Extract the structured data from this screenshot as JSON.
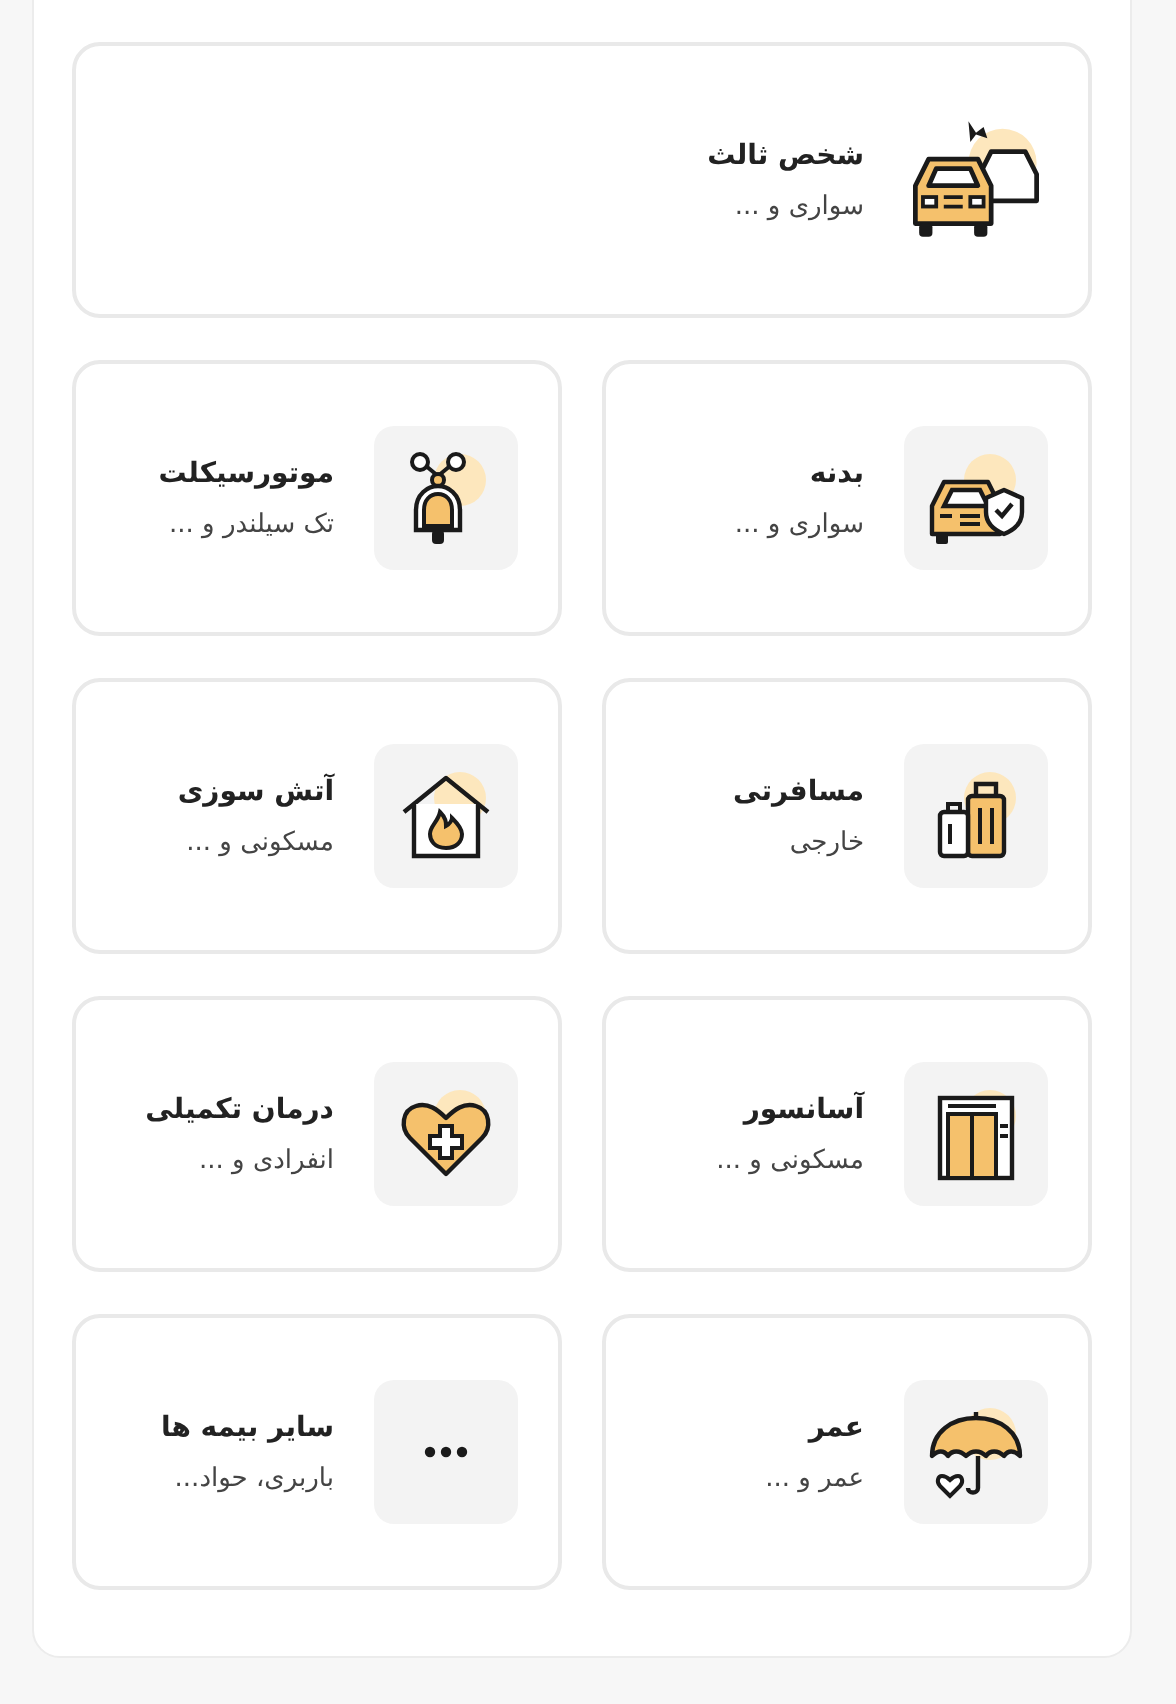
{
  "featured": {
    "title": "شخص ثالث",
    "subtitle": "سواری و ..."
  },
  "items": [
    {
      "title": "بدنه",
      "subtitle": "سواری و ..."
    },
    {
      "title": "موتورسیکلت",
      "subtitle": "تک سیلندر و ..."
    },
    {
      "title": "مسافرتی",
      "subtitle": "خارجی"
    },
    {
      "title": "آتش سوزی",
      "subtitle": "مسکونی و ..."
    },
    {
      "title": "آسانسور",
      "subtitle": "مسکونی و ..."
    },
    {
      "title": "درمان تکمیلی",
      "subtitle": "انفرادی و ..."
    },
    {
      "title": "عمر",
      "subtitle": "عمر و ..."
    },
    {
      "title": "سایر بیمه ها",
      "subtitle": "باربری، حواد..."
    }
  ]
}
